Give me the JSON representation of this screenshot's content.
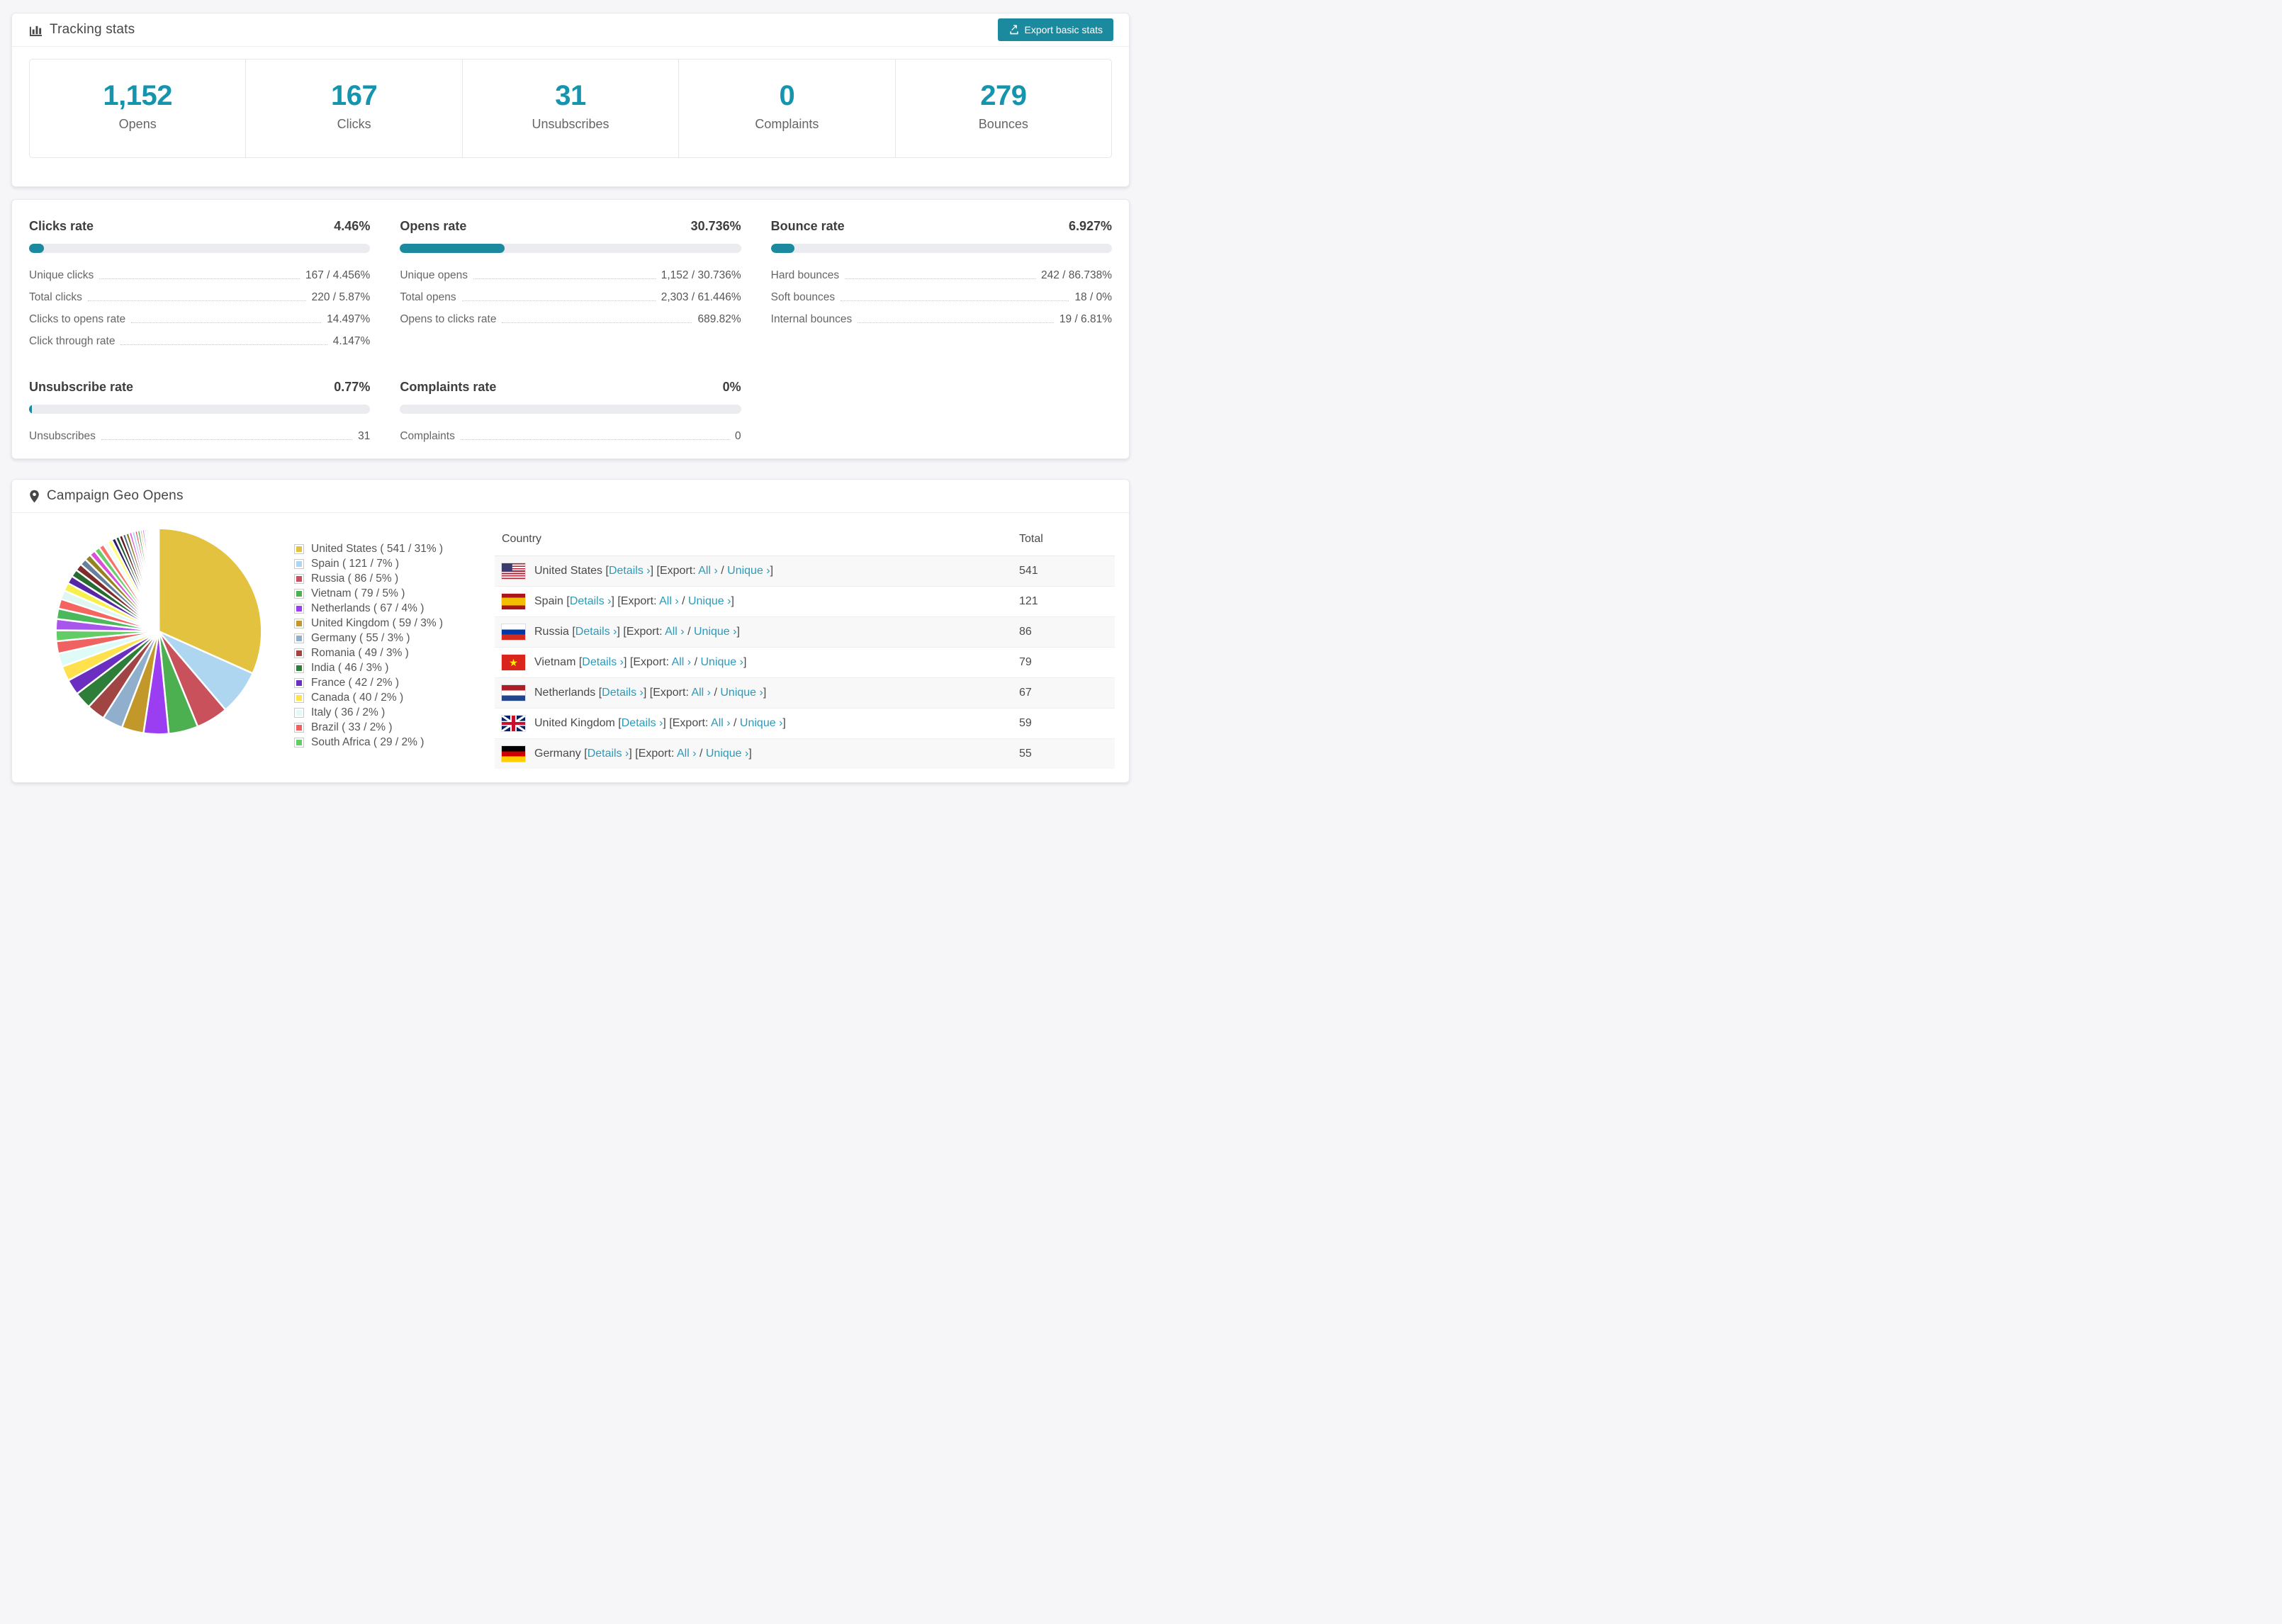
{
  "colors": {
    "accent": "#1c8a9e",
    "number": "#1594ad",
    "link": "#2b9ab8",
    "bar_track": "#eaecef"
  },
  "tracking": {
    "title": "Tracking stats",
    "icon": "bar-chart-icon",
    "export_button": "Export basic stats",
    "summary": [
      {
        "value": "1,152",
        "label": "Opens"
      },
      {
        "value": "167",
        "label": "Clicks"
      },
      {
        "value": "31",
        "label": "Unsubscribes"
      },
      {
        "value": "0",
        "label": "Complaints"
      },
      {
        "value": "279",
        "label": "Bounces"
      }
    ]
  },
  "rates": [
    {
      "name": "Clicks rate",
      "value": "4.46%",
      "percent": 4.46,
      "rows": [
        {
          "label": "Unique clicks",
          "value": "167 / 4.456%"
        },
        {
          "label": "Total clicks",
          "value": "220 / 5.87%"
        },
        {
          "label": "Clicks to opens rate",
          "value": "14.497%"
        },
        {
          "label": "Click through rate",
          "value": "4.147%"
        }
      ]
    },
    {
      "name": "Opens rate",
      "value": "30.736%",
      "percent": 30.736,
      "rows": [
        {
          "label": "Unique opens",
          "value": "1,152 / 30.736%"
        },
        {
          "label": "Total opens",
          "value": "2,303 / 61.446%"
        },
        {
          "label": "Opens to clicks rate",
          "value": "689.82%"
        }
      ]
    },
    {
      "name": "Bounce rate",
      "value": "6.927%",
      "percent": 6.927,
      "rows": [
        {
          "label": "Hard bounces",
          "value": "242 / 86.738%"
        },
        {
          "label": "Soft bounces",
          "value": "18 / 0%"
        },
        {
          "label": "Internal bounces",
          "value": "19 / 6.81%"
        }
      ]
    },
    {
      "name": "Unsubscribe rate",
      "value": "0.77%",
      "percent": 0.77,
      "rows": [
        {
          "label": "Unsubscribes",
          "value": "31"
        }
      ]
    },
    {
      "name": "Complaints rate",
      "value": "0%",
      "percent": 0,
      "rows": [
        {
          "label": "Complaints",
          "value": "0"
        }
      ]
    }
  ],
  "geo": {
    "title": "Campaign Geo Opens",
    "icon": "map-pin-icon",
    "table": {
      "headers": [
        "Country",
        "Total"
      ],
      "links": {
        "details": "Details ›",
        "all": "All ›",
        "unique": "Unique ›",
        "export_label": "Export:"
      },
      "punct": {
        "open": "[",
        "close": "]",
        "slash": "/"
      },
      "rows": [
        {
          "flag": "us",
          "country": "United States",
          "total": "541"
        },
        {
          "flag": "es",
          "country": "Spain",
          "total": "121"
        },
        {
          "flag": "ru",
          "country": "Russia",
          "total": "86"
        },
        {
          "flag": "vn",
          "country": "Vietnam",
          "total": "79"
        },
        {
          "flag": "nl",
          "country": "Netherlands",
          "total": "67"
        },
        {
          "flag": "gb",
          "country": "United Kingdom",
          "total": "59"
        },
        {
          "flag": "de",
          "country": "Germany",
          "total": "55"
        }
      ]
    }
  },
  "chart_data": {
    "type": "pie",
    "title": "Campaign Geo Opens",
    "legend_position": "right",
    "start_angle": "top",
    "direction": "clockwise",
    "slices": [
      {
        "label": "United States",
        "value": 541,
        "pct": "31%",
        "color": "#e3c23f"
      },
      {
        "label": "Spain",
        "value": 121,
        "pct": "7%",
        "color": "#aed6f1"
      },
      {
        "label": "Russia",
        "value": 86,
        "pct": "5%",
        "color": "#c9515c"
      },
      {
        "label": "Vietnam",
        "value": 79,
        "pct": "5%",
        "color": "#4caf50"
      },
      {
        "label": "Netherlands",
        "value": 67,
        "pct": "4%",
        "color": "#9b3df0"
      },
      {
        "label": "United Kingdom",
        "value": 59,
        "pct": "3%",
        "color": "#c2982a"
      },
      {
        "label": "Germany",
        "value": 55,
        "pct": "3%",
        "color": "#8fafcc"
      },
      {
        "label": "Romania",
        "value": 49,
        "pct": "3%",
        "color": "#a04444"
      },
      {
        "label": "India",
        "value": 46,
        "pct": "3%",
        "color": "#2e7d38"
      },
      {
        "label": "France",
        "value": 42,
        "pct": "2%",
        "color": "#6a2fc0"
      },
      {
        "label": "Canada",
        "value": 40,
        "pct": "2%",
        "color": "#ffe14d"
      },
      {
        "label": "Italy",
        "value": 36,
        "pct": "2%",
        "color": "#dffbf8"
      },
      {
        "label": "Brazil",
        "value": 33,
        "pct": "2%",
        "color": "#f06262"
      },
      {
        "label": "South Africa",
        "value": 29,
        "pct": "2%",
        "color": "#63cc66"
      }
    ],
    "other_slices": {
      "values": [
        30,
        28,
        26,
        24,
        22,
        21,
        20,
        19,
        18,
        17,
        16,
        15,
        14,
        13,
        12,
        11,
        10,
        10,
        9,
        9,
        8,
        8,
        7,
        7,
        6,
        6,
        5,
        5,
        4,
        4,
        3,
        3,
        3,
        2,
        2,
        2,
        2,
        1,
        1,
        1
      ],
      "palette": [
        "#a855ee",
        "#4cb85c",
        "#f5655f",
        "#dff6f2",
        "#f7ef4a",
        "#5527a5",
        "#276b30",
        "#7e2c2c",
        "#67809c",
        "#94831f",
        "#d94fd9",
        "#66cf69",
        "#fa736b",
        "#f0fdfb",
        "#ffff70",
        "#2b2172",
        "#1c5a2c",
        "#5e1d1d",
        "#4e6a82",
        "#8a7a1e",
        "#e55ae5",
        "#a8d4f2",
        "#d6454f",
        "#3da04b",
        "#d4ac28"
      ]
    }
  }
}
